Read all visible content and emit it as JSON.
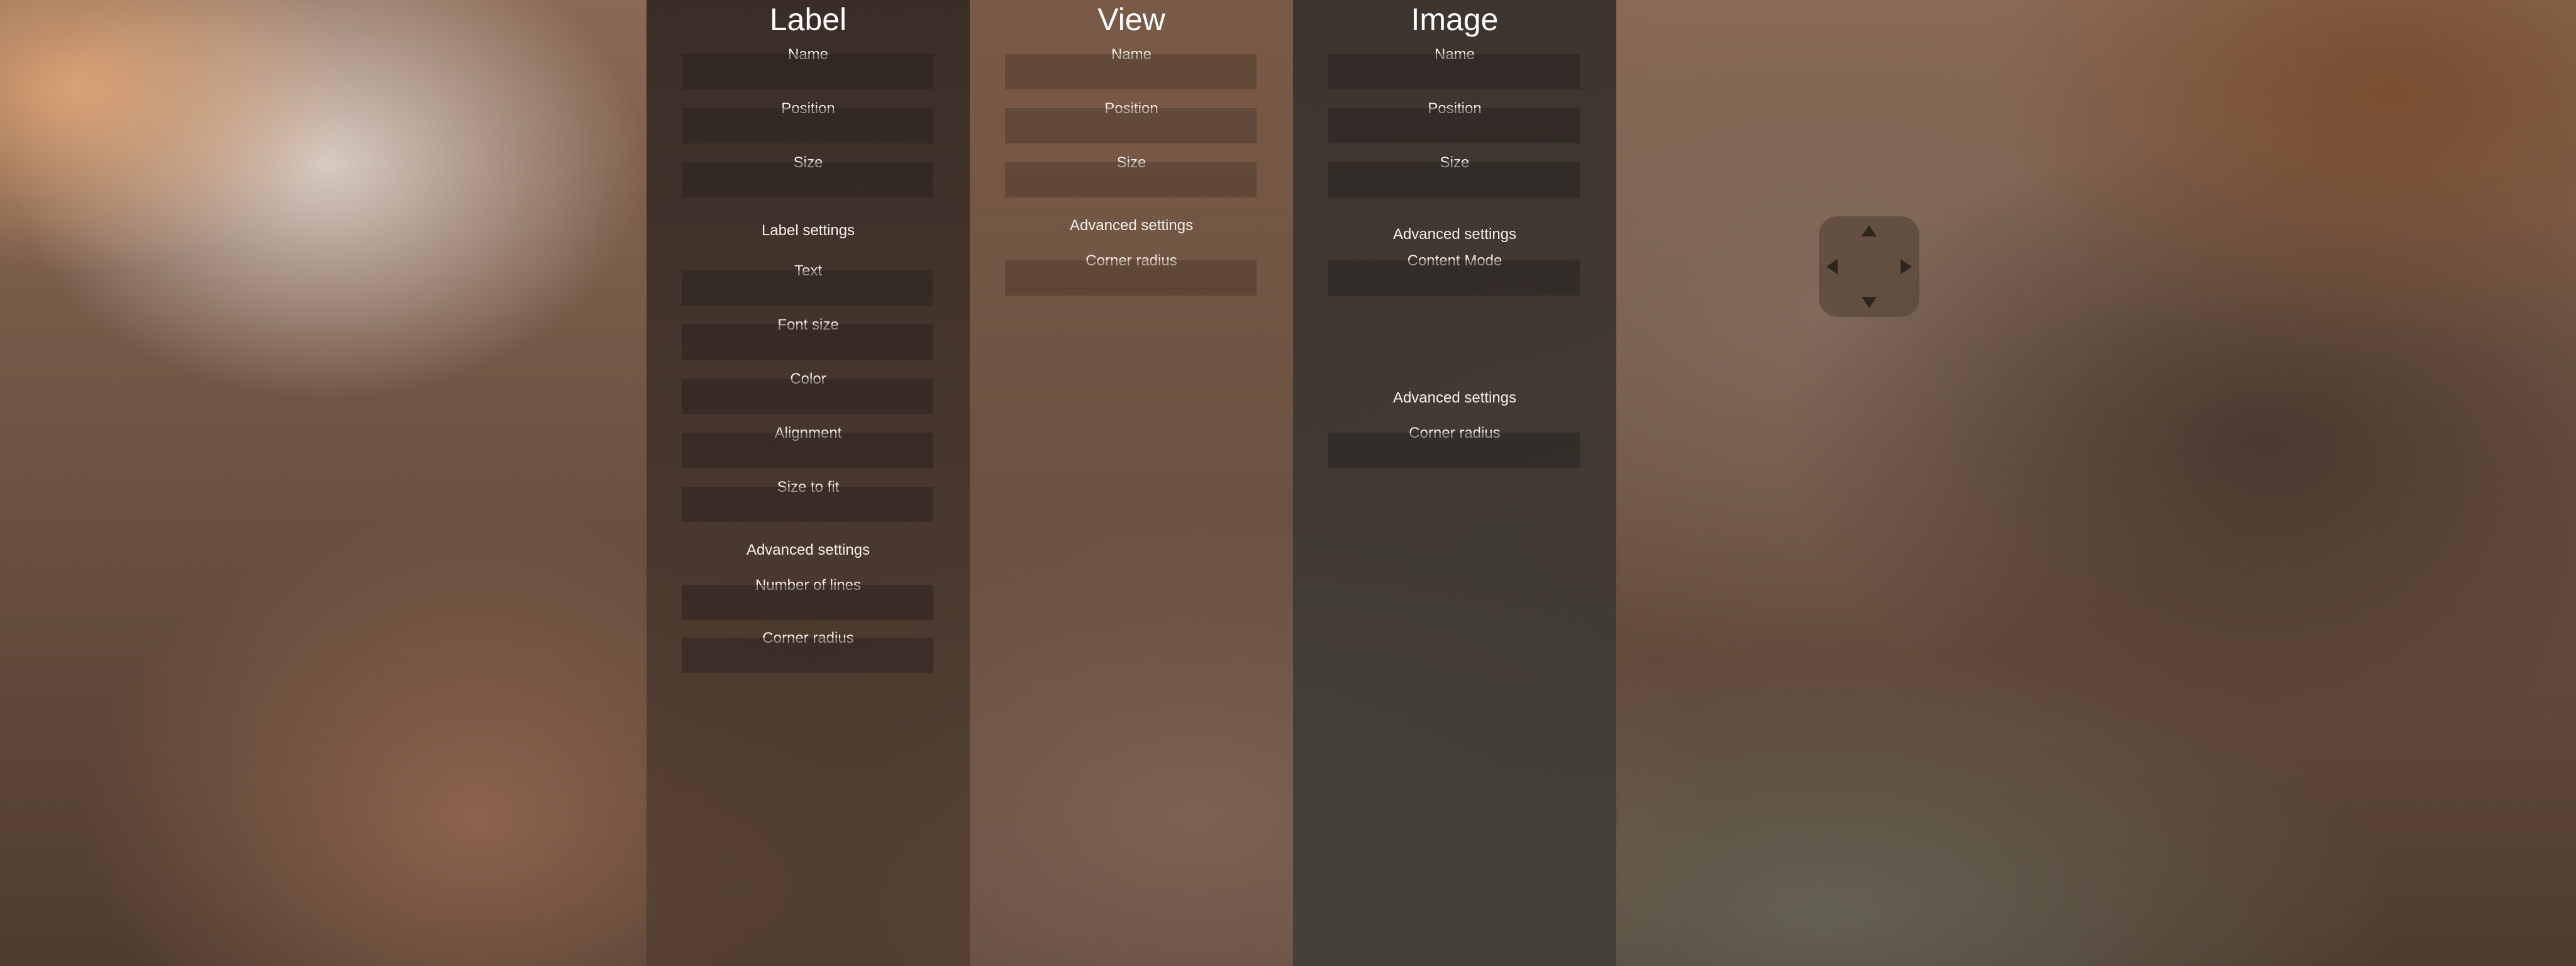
{
  "label_panel": {
    "title": "Label",
    "name_label": "Name",
    "position_label": "Position",
    "size_label": "Size",
    "section_label_settings": "Label settings",
    "text_label": "Text",
    "font_size_label": "Font size",
    "color_label": "Color",
    "alignment_label": "Alignment",
    "size_to_fit_label": "Size to fit",
    "section_advanced": "Advanced settings",
    "number_of_lines_label": "Number of lines",
    "corner_radius_label": "Corner radius"
  },
  "view_panel": {
    "title": "View",
    "name_label": "Name",
    "position_label": "Position",
    "size_label": "Size",
    "section_advanced": "Advanced settings",
    "corner_radius_label": "Corner radius"
  },
  "image_panel": {
    "title": "Image",
    "name_label": "Name",
    "position_label": "Position",
    "size_label": "Size",
    "section_advanced_1": "Advanced settings",
    "content_mode_label": "Content Mode",
    "section_advanced_2": "Advanced settings",
    "corner_radius_label": "Corner radius"
  },
  "dpad": {
    "up": "arrow-up-icon",
    "down": "arrow-down-icon",
    "left": "arrow-left-icon",
    "right": "arrow-right-icon"
  }
}
